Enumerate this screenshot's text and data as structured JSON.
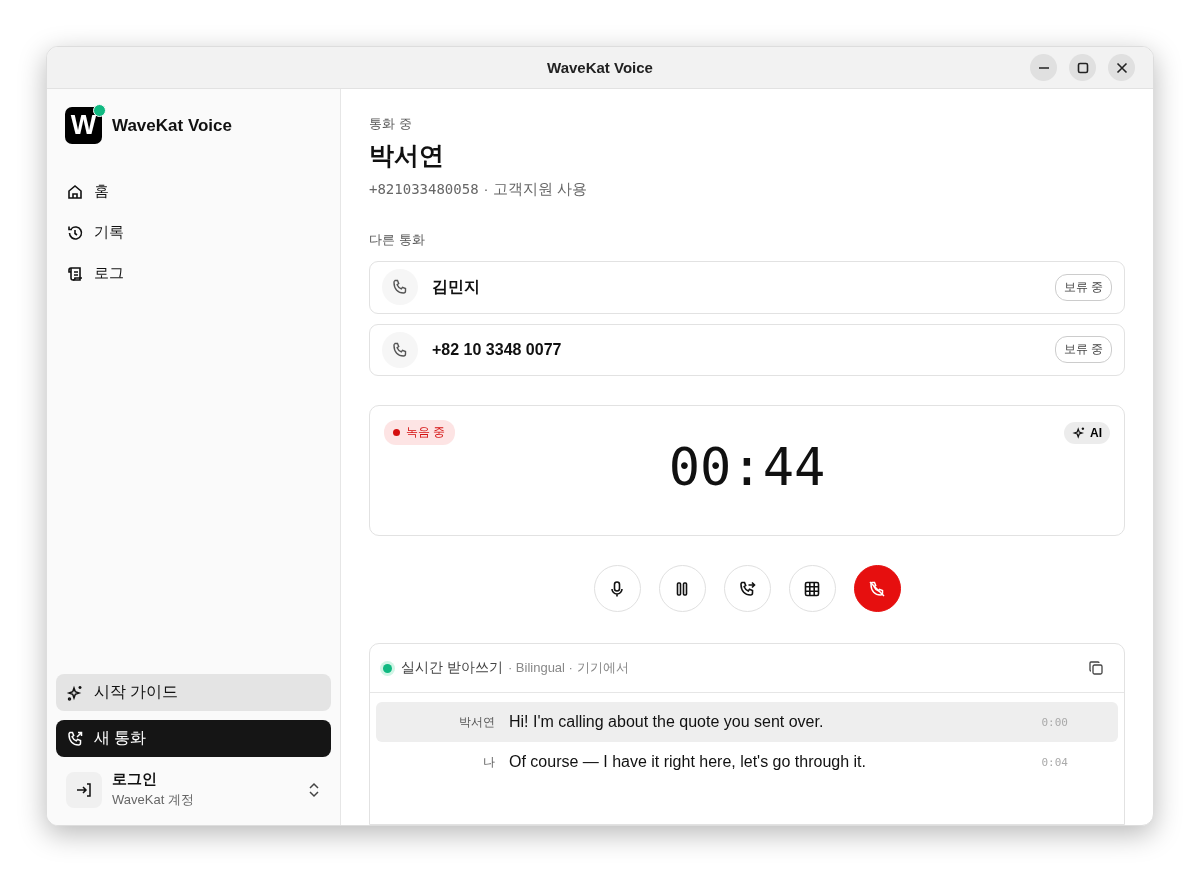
{
  "window": {
    "title": "WaveKat Voice"
  },
  "sidebar": {
    "app_name": "WaveKat Voice",
    "logo_letter": "W",
    "online": true,
    "items": [
      {
        "label": "홈",
        "kind": "home",
        "selected": false
      },
      {
        "label": "기록",
        "kind": "history",
        "selected": false
      },
      {
        "label": "로그",
        "kind": "scroll",
        "selected": false
      }
    ],
    "guide_button": "시작 가이드",
    "new_call_button": "새 통화",
    "account": {
      "name": "로그인",
      "subtitle": "WaveKat 계정"
    }
  },
  "call": {
    "status": "통화 중",
    "name": "박서연",
    "number": "+821033480058",
    "detail": "· 고객지원 사용"
  },
  "other_calls": {
    "heading": "다른 통화",
    "items": [
      {
        "name": "김민지",
        "badge": "보류 중"
      },
      {
        "name": "+82 10 3348 0077",
        "badge": "보류 중"
      }
    ]
  },
  "timer": {
    "recording": true,
    "recording_label": "녹음 중",
    "ai_label": "AI",
    "time": "00:44"
  },
  "controls": [
    {
      "kind": "mic"
    },
    {
      "kind": "pause"
    },
    {
      "kind": "transfer"
    },
    {
      "kind": "keypad"
    },
    {
      "kind": "hangup"
    }
  ],
  "transcript": {
    "title": "실시간 받아쓰기",
    "meta": "· Bilingual · 기기에서",
    "live": true,
    "lines": [
      {
        "speaker": "박서연",
        "text": "Hi! I'm calling about the quote you sent over.",
        "time": "0:00",
        "selected": true
      },
      {
        "speaker": "나",
        "text": "Of course — I have it right here, let's go through it.",
        "time": "0:04",
        "selected": false
      }
    ]
  }
}
